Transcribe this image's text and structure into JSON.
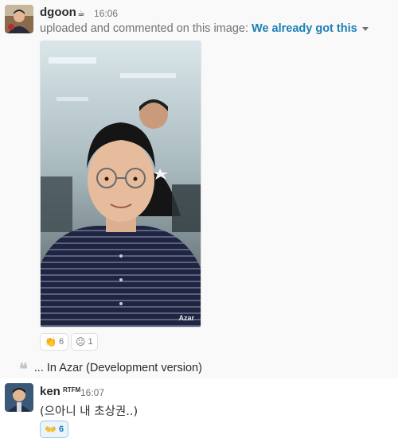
{
  "message1": {
    "author": "dgoon",
    "status_emoji": "☕",
    "time": "16:06",
    "action_text": "uploaded and commented on this image: ",
    "file_title": "We already got this",
    "image_watermark": "Azar",
    "reactions": [
      {
        "emoji": "👏",
        "count": "6"
      },
      {
        "emoji": "😐",
        "count": "1"
      }
    ],
    "comment_text": "... In Azar (Development version)"
  },
  "message2": {
    "author": "ken",
    "status_emoji": "RTFM",
    "time": "16:07",
    "text": "(으아니 내 초상권..)",
    "reactions": [
      {
        "emoji": "👐",
        "count": "6"
      }
    ]
  },
  "colors": {
    "link": "#1d7fb5",
    "muted": "#717274",
    "reaction_selected_bg": "#eaf4fa"
  }
}
